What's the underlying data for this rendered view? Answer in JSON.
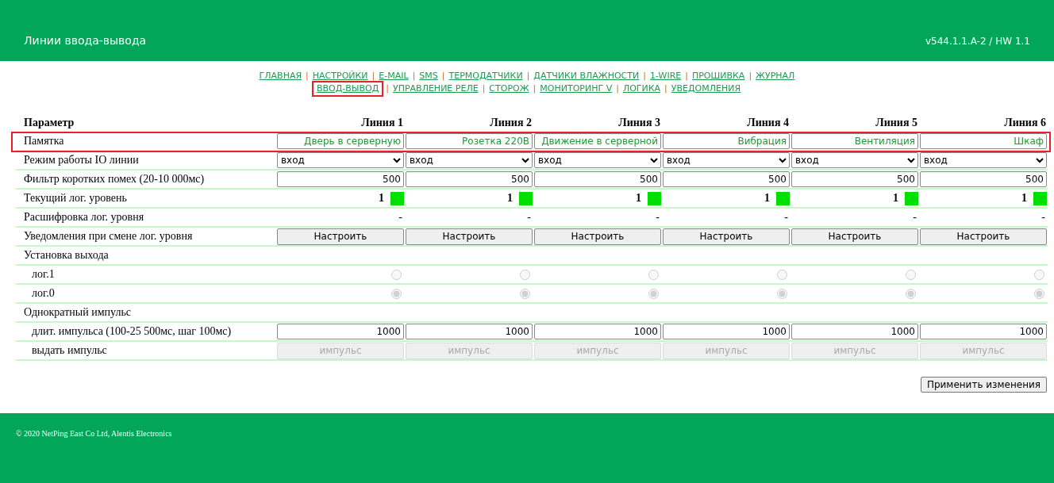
{
  "header": {
    "title": "Линии ввода-вывода",
    "version": "v544.1.1.A-2 / HW 1.1"
  },
  "nav": {
    "separator": "|",
    "lines": [
      {
        "links": [
          {
            "label": "ГЛАВНАЯ",
            "selected": false
          },
          {
            "label": "НАСТРОЙКИ",
            "selected": false
          },
          {
            "label": "E-MAIL",
            "selected": false
          },
          {
            "label": "SMS",
            "selected": false
          },
          {
            "label": "ТЕРМОДАТЧИКИ",
            "selected": false
          },
          {
            "label": "ДАТЧИКИ ВЛАЖНОСТИ",
            "selected": false
          },
          {
            "label": "1-WIRE",
            "selected": false
          },
          {
            "label": "ПРОШИВКА",
            "selected": false
          },
          {
            "label": "ЖУРНАЛ",
            "selected": false
          }
        ]
      },
      {
        "links": [
          {
            "label": "ВВОД-ВЫВОД",
            "selected": true
          },
          {
            "label": "УПРАВЛЕНИЕ РЕЛЕ",
            "selected": false
          },
          {
            "label": "СТОРОЖ",
            "selected": false
          },
          {
            "label": "МОНИТОРИНГ V",
            "selected": false
          },
          {
            "label": "ЛОГИКА",
            "selected": false
          },
          {
            "label": "УВЕДОМЛЕНИЯ",
            "selected": false
          }
        ]
      }
    ]
  },
  "table": {
    "parameter_heading": "Параметр",
    "columns": [
      "Линия 1",
      "Линия 2",
      "Линия 3",
      "Линия 4",
      "Линия 5",
      "Линия 6"
    ],
    "rows": [
      {
        "kind": "memo",
        "label": "Памятка",
        "indent": false,
        "highlighted": true,
        "cells": [
          "Дверь в серверную",
          "Розетка 220В",
          "Движение в серверной",
          "Вибрация",
          "Вентиляция",
          "Шкаф"
        ]
      },
      {
        "kind": "select",
        "label": "Режим работы IO линии",
        "indent": false,
        "highlighted": false,
        "cells": [
          "вход",
          "вход",
          "вход",
          "вход",
          "вход",
          "вход"
        ]
      },
      {
        "kind": "number",
        "label": "Фильтр коротких помех (20-10 000мс)",
        "indent": false,
        "highlighted": false,
        "cells": [
          "500",
          "500",
          "500",
          "500",
          "500",
          "500"
        ]
      },
      {
        "kind": "level",
        "label": "Текущий лог. уровень",
        "indent": false,
        "highlighted": false,
        "cells": [
          {
            "value": "1",
            "color": "#00e000"
          },
          {
            "value": "1",
            "color": "#00e000"
          },
          {
            "value": "1",
            "color": "#00e000"
          },
          {
            "value": "1",
            "color": "#00e000"
          },
          {
            "value": "1",
            "color": "#00e000"
          },
          {
            "value": "1",
            "color": "#00e000"
          }
        ]
      },
      {
        "kind": "text",
        "label": "Расшифровка лог. уровня",
        "indent": false,
        "highlighted": false,
        "cells": [
          "-",
          "-",
          "-",
          "-",
          "-",
          "-"
        ]
      },
      {
        "kind": "button",
        "label": "Уведомления при смене лог. уровня",
        "indent": false,
        "highlighted": false,
        "disabled": false,
        "cells": [
          "Настроить",
          "Настроить",
          "Настроить",
          "Настроить",
          "Настроить",
          "Настроить"
        ]
      },
      {
        "kind": "section",
        "label": "Установка выхода",
        "indent": false,
        "highlighted": false
      },
      {
        "kind": "radio",
        "label": "лог.1",
        "indent": true,
        "highlighted": false,
        "cells": [
          {
            "checked": false
          },
          {
            "checked": false
          },
          {
            "checked": false
          },
          {
            "checked": false
          },
          {
            "checked": false
          },
          {
            "checked": false
          }
        ]
      },
      {
        "kind": "radio",
        "label": "лог.0",
        "indent": true,
        "highlighted": false,
        "cells": [
          {
            "checked": true
          },
          {
            "checked": true
          },
          {
            "checked": true
          },
          {
            "checked": true
          },
          {
            "checked": true
          },
          {
            "checked": true
          }
        ]
      },
      {
        "kind": "section",
        "label": "Однократный импульс",
        "indent": false,
        "highlighted": false
      },
      {
        "kind": "number",
        "label": "длит. импульса (100-25 500мс, шаг 100мс)",
        "indent": true,
        "highlighted": false,
        "cells": [
          "1000",
          "1000",
          "1000",
          "1000",
          "1000",
          "1000"
        ]
      },
      {
        "kind": "button",
        "label": "выдать импульс",
        "indent": true,
        "highlighted": false,
        "disabled": true,
        "cells": [
          "импульс",
          "импульс",
          "импульс",
          "импульс",
          "импульс",
          "импульс"
        ]
      }
    ]
  },
  "apply_button": "Применить изменения",
  "footer": "© 2020 NetPing East Co Ltd, Alentis Electronics"
}
